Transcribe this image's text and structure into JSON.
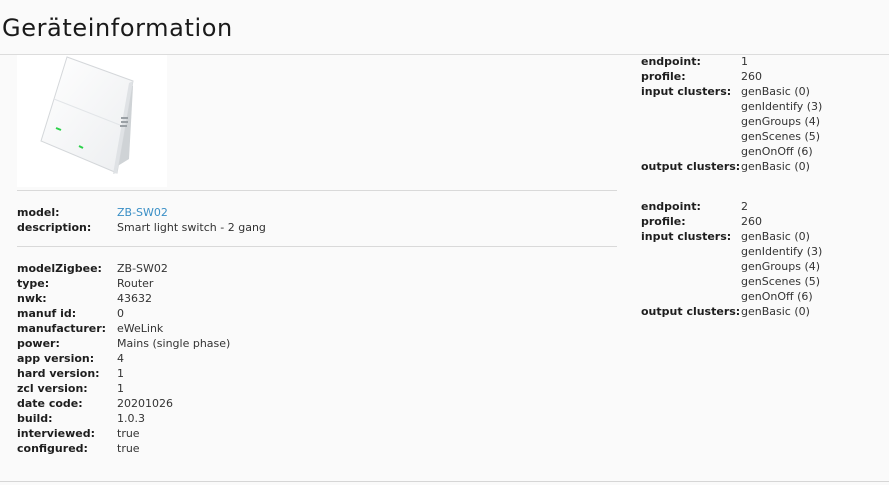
{
  "page": {
    "title": "Geräteinformation"
  },
  "device_image": {
    "alt": "Smart light switch - 2 gang",
    "indicator_color": "#2bd14a"
  },
  "summary": [
    {
      "key": "model:",
      "value": "ZB-SW02",
      "link": true
    },
    {
      "key": "description:",
      "value": "Smart light switch - 2 gang",
      "link": false
    }
  ],
  "details": [
    {
      "key": "modelZigbee:",
      "value": "ZB-SW02"
    },
    {
      "key": "type:",
      "value": "Router"
    },
    {
      "key": "nwk:",
      "value": "43632"
    },
    {
      "key": "manuf id:",
      "value": "0"
    },
    {
      "key": "manufacturer:",
      "value": "eWeLink"
    },
    {
      "key": "power:",
      "value": "Mains (single phase)"
    },
    {
      "key": "app version:",
      "value": "4"
    },
    {
      "key": "hard version:",
      "value": "1"
    },
    {
      "key": "zcl version:",
      "value": "1"
    },
    {
      "key": "date code:",
      "value": "20201026"
    },
    {
      "key": "build:",
      "value": "1.0.3"
    },
    {
      "key": "interviewed:",
      "value": "true"
    },
    {
      "key": "configured:",
      "value": "true"
    }
  ],
  "endpoint_labels": {
    "endpoint": "endpoint:",
    "profile": "profile:",
    "input": "input clusters:",
    "output": "output clusters:"
  },
  "endpoints": [
    {
      "endpoint": "1",
      "profile": "260",
      "input_clusters": [
        "genBasic (0)",
        "genIdentify (3)",
        "genGroups (4)",
        "genScenes (5)",
        "genOnOff (6)"
      ],
      "output_clusters": [
        "genBasic (0)"
      ]
    },
    {
      "endpoint": "2",
      "profile": "260",
      "input_clusters": [
        "genBasic (0)",
        "genIdentify (3)",
        "genGroups (4)",
        "genScenes (5)",
        "genOnOff (6)"
      ],
      "output_clusters": [
        "genBasic (0)"
      ]
    }
  ]
}
